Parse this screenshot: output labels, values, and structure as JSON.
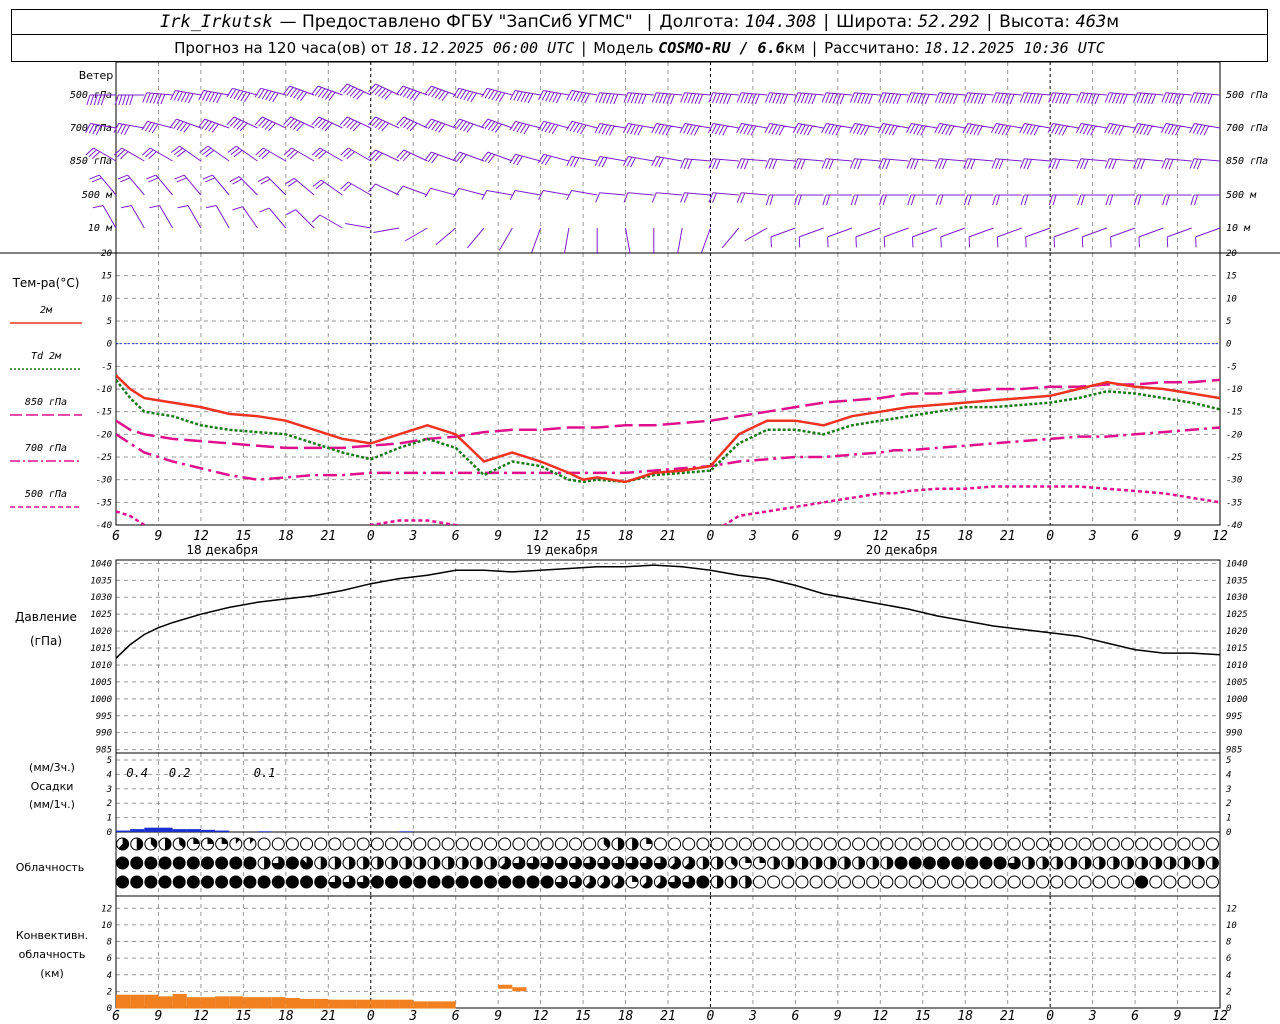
{
  "header": {
    "station": "Irk_Irkutsk",
    "provider": "— Предоставлено ФГБУ \"ЗапСиб УГМС\"",
    "lon_label": "Долгота:",
    "lon": "104.308",
    "lat_label": "Широта:",
    "lat": "52.292",
    "alt_label": "Высота:",
    "alt": "463",
    "alt_unit": "м",
    "forecast_label": "Прогноз на 120 часа(ов) от",
    "forecast_start": "18.12.2025 06:00 UTC",
    "model_label": "Модель",
    "model": "COSMO-RU / 6.6",
    "model_unit": "км",
    "calc_label": "Рассчитано:",
    "calc_time": "18.12.2025 10:36 UTC"
  },
  "wind_panel": {
    "title": "Ветер",
    "levels": [
      "500 гПа",
      "700 гПа",
      "850 гПа",
      "500 м",
      "10  м"
    ],
    "color": "#7b1fd0"
  },
  "temp_panel": {
    "title": "Тем-ра(°C)",
    "legend": [
      {
        "label": "2м",
        "color": "#ee3322",
        "style": "solid"
      },
      {
        "label": "Td  2м",
        "color": "#1a7a1a",
        "style": "dot"
      },
      {
        "label": "850 гПа",
        "color": "#e0108c",
        "style": "longdash"
      },
      {
        "label": "700 гПа",
        "color": "#e0108c",
        "style": "dashdot"
      },
      {
        "label": "500 гПа",
        "color": "#e0108c",
        "style": "dash"
      }
    ],
    "yticks": [
      20,
      15,
      10,
      5,
      0,
      -5,
      -10,
      -15,
      -20,
      -25,
      -30,
      -35,
      -40
    ]
  },
  "pressure_panel": {
    "title": "Давление",
    "unit": "(гПа)",
    "yticks": [
      1040,
      1035,
      1030,
      1025,
      1020,
      1015,
      1010,
      1005,
      1000,
      995,
      990,
      985
    ]
  },
  "precip_panel": {
    "unit1": "(мм/3ч.)",
    "title": "Осадки",
    "unit2": "(мм/1ч.)",
    "yticks": [
      5,
      4,
      3,
      2,
      1,
      0
    ],
    "annotations": [
      {
        "x": 1.5,
        "text": "0.4"
      },
      {
        "x": 4.5,
        "text": "0.2"
      },
      {
        "x": 10.5,
        "text": "0.1"
      }
    ]
  },
  "cloud_panel": {
    "title": "Облачность"
  },
  "conv_panel": {
    "title1": "Конвективн.",
    "title2": "облачность",
    "unit": "(км)",
    "yticks": [
      12,
      10,
      8,
      6,
      4,
      2,
      0
    ]
  },
  "days": [
    {
      "x": 7.5,
      "label": "18 декабря"
    },
    {
      "x": 31.5,
      "label": "19 декабря"
    },
    {
      "x": 55.5,
      "label": "20 декабря"
    }
  ],
  "hour_labels": [
    "6",
    "9",
    "12",
    "15",
    "18",
    "21",
    "0",
    "3",
    "6",
    "9",
    "12",
    "15",
    "18",
    "21",
    "0",
    "3",
    "6",
    "9",
    "12",
    "15",
    "18",
    "21",
    "0",
    "3",
    "6",
    "9",
    "12"
  ],
  "chart_data": {
    "type": "line",
    "x_axis": "hours since 18.12.2025 06:00 UTC",
    "x_range": [
      0,
      78
    ],
    "temperature": {
      "x": [
        0,
        1,
        2,
        4,
        6,
        8,
        10,
        12,
        14,
        16,
        18,
        20,
        22,
        24,
        26,
        28,
        30,
        32,
        33,
        34,
        36,
        38,
        40,
        42,
        44,
        46,
        48,
        50,
        52,
        54,
        55,
        56,
        58,
        60,
        62,
        64,
        66,
        68,
        70,
        72,
        74,
        76,
        78
      ],
      "t2m": [
        -7,
        -10,
        -12,
        -13,
        -14,
        -15.5,
        -16,
        -17,
        -19,
        -21,
        -22,
        -20,
        -18,
        -20,
        -26,
        -24,
        -26,
        -28.5,
        -30,
        -29.5,
        -30.5,
        -28.5,
        -28,
        -27,
        -20,
        -17,
        -17,
        -18,
        -16,
        -15,
        -14.5,
        -14,
        -13.5,
        -13,
        -12.5,
        -12,
        -11.5,
        -10,
        -8.5,
        -9.5,
        -10,
        -11,
        -12
      ],
      "td2m": [
        -8,
        -12,
        -15,
        -16,
        -18,
        -19,
        -19.5,
        -20,
        -22,
        -24,
        -25.5,
        -23,
        -21,
        -23,
        -29,
        -26,
        -27,
        -30,
        -30.5,
        -30,
        -30.5,
        -29,
        -28.5,
        -28,
        -22,
        -19,
        -19,
        -20,
        -18,
        -17,
        -16.5,
        -16,
        -15,
        -14,
        -14,
        -13.5,
        -13,
        -12,
        -10.5,
        -11,
        -12,
        -13,
        -14.5
      ],
      "t850": [
        -17,
        -19,
        -20,
        -21,
        -21.5,
        -22,
        -22.5,
        -23,
        -23,
        -23,
        -22.5,
        -22,
        -21,
        -20.5,
        -19.5,
        -19,
        -19,
        -18.5,
        -18.5,
        -18.5,
        -18,
        -18,
        -17.5,
        -17,
        -16,
        -15,
        -14,
        -13,
        -12.5,
        -12,
        -11.5,
        -11,
        -11,
        -10.5,
        -10,
        -10,
        -9.5,
        -9.5,
        -9,
        -9,
        -8.5,
        -8.5,
        -8
      ],
      "t700": [
        -20,
        -22,
        -24,
        -26,
        -27.5,
        -29,
        -30,
        -29.5,
        -29,
        -29,
        -28.5,
        -28.5,
        -28.5,
        -28.5,
        -28.5,
        -28.5,
        -28.5,
        -28.5,
        -28.5,
        -28.5,
        -28.5,
        -28,
        -27.5,
        -27,
        -26,
        -25.5,
        -25,
        -25,
        -24.5,
        -24,
        -23.5,
        -23.5,
        -23,
        -22.5,
        -22,
        -21.5,
        -21,
        -20.5,
        -20.5,
        -20,
        -19.5,
        -19,
        -18.5
      ],
      "t500": [
        -37,
        -38,
        -40,
        -42,
        -44,
        -45,
        -45,
        -45,
        -45,
        -44,
        -40,
        -39,
        -39,
        -40,
        -43,
        -45,
        -46,
        -47,
        -46,
        -46,
        -45,
        -44,
        -43,
        -42,
        -38,
        -37,
        -36,
        -35,
        -34,
        -33,
        -33,
        -32.5,
        -32,
        -32,
        -31.5,
        -31.5,
        -31.5,
        -31.5,
        -32,
        -32.5,
        -33,
        -34,
        -35
      ]
    },
    "pressure": {
      "x": [
        0,
        1,
        2,
        3,
        4,
        6,
        8,
        10,
        12,
        14,
        16,
        18,
        20,
        22,
        24,
        26,
        28,
        30,
        32,
        34,
        36,
        38,
        40,
        42,
        44,
        46,
        48,
        50,
        52,
        54,
        56,
        58,
        60,
        62,
        64,
        66,
        68,
        70,
        72,
        74,
        76,
        78
      ],
      "values": [
        1012,
        1016,
        1019,
        1021,
        1022.5,
        1025,
        1027,
        1028.5,
        1029.5,
        1030.5,
        1032,
        1034,
        1035.5,
        1036.5,
        1038,
        1038,
        1037.5,
        1038,
        1038.5,
        1039,
        1039,
        1039.5,
        1039,
        1038,
        1036.5,
        1035.5,
        1033.5,
        1031,
        1029.5,
        1028,
        1026.5,
        1024.5,
        1023,
        1021.5,
        1020.5,
        1019.5,
        1018.5,
        1016.5,
        1014.5,
        1013.5,
        1013.5,
        1013
      ]
    },
    "precip": {
      "x": [
        0,
        1,
        2,
        3,
        4,
        5,
        6,
        7,
        10,
        20
      ],
      "values": [
        0.1,
        0.2,
        0.3,
        0.3,
        0.2,
        0.2,
        0.15,
        0.1,
        0.05,
        0.05
      ],
      "color": "#1a2fd0"
    },
    "convective_cloud": {
      "x": [
        0,
        1,
        2,
        3,
        4,
        5,
        6,
        7,
        8,
        9,
        10,
        11,
        12,
        13,
        14,
        15,
        16,
        17,
        18,
        19,
        20,
        21,
        22,
        23,
        24,
        25,
        26,
        27,
        28,
        29,
        30,
        31,
        32,
        33,
        34,
        35,
        36,
        37,
        38,
        39,
        40,
        41,
        42,
        43,
        44,
        45,
        46,
        47,
        48,
        49,
        50,
        51,
        52,
        53,
        54,
        55,
        56,
        57,
        58,
        59,
        60,
        61,
        62,
        63,
        64,
        65,
        66,
        67,
        68,
        69,
        70,
        71,
        72,
        73,
        74,
        75,
        76,
        77
      ],
      "values": [
        1.6,
        1.6,
        1.6,
        1.4,
        1.7,
        1.3,
        1.3,
        1.4,
        1.4,
        1.3,
        1.3,
        1.3,
        1.2,
        1.1,
        1.1,
        1.0,
        1.0,
        1.0,
        1.0,
        1.0,
        1.0,
        0.8,
        0.8,
        0.8,
        0,
        0,
        0,
        0,
        0,
        0,
        0,
        0,
        0,
        0,
        0,
        0,
        0,
        0,
        0,
        0,
        0,
        0,
        0,
        0,
        0,
        0,
        0,
        0,
        0,
        0,
        0,
        0,
        0,
        0,
        0,
        0,
        0,
        0,
        0,
        0,
        0,
        0,
        0,
        0,
        0,
        0,
        0,
        0,
        0,
        0,
        0,
        0,
        0,
        0,
        0,
        0,
        0,
        0
      ],
      "high_blocks": [
        {
          "x": 27,
          "values": [
            2.8,
            2.5
          ]
        }
      ],
      "color": "#f08020"
    },
    "clouds": {
      "x_step": 1,
      "low": [
        5,
        4,
        3,
        4,
        3,
        2,
        2,
        2,
        1,
        1,
        0,
        0,
        0,
        0,
        0,
        0,
        0,
        0,
        0,
        0,
        0,
        0,
        0,
        0,
        0,
        0,
        0,
        0,
        0,
        0,
        0,
        0,
        0,
        0,
        3,
        4,
        4,
        2,
        0,
        0,
        0,
        0,
        0,
        0,
        0,
        0,
        0,
        0,
        0,
        0,
        0,
        0,
        0,
        0,
        0,
        0,
        0,
        0,
        0,
        0,
        0,
        0,
        0,
        0,
        0,
        0,
        0,
        0,
        0,
        0,
        0,
        0,
        0,
        0,
        0,
        0,
        0,
        0
      ],
      "mid": [
        8,
        8,
        8,
        8,
        8,
        8,
        8,
        8,
        8,
        8,
        4,
        6,
        8,
        7,
        4,
        4,
        4,
        4,
        4,
        4,
        4,
        4,
        4,
        4,
        4,
        4,
        4,
        5,
        6,
        6,
        6,
        6,
        6,
        6,
        6,
        6,
        6,
        6,
        6,
        5,
        5,
        4,
        4,
        3,
        2,
        2,
        4,
        4,
        4,
        4,
        4,
        4,
        4,
        4,
        4,
        8,
        8,
        8,
        8,
        8,
        8,
        8,
        8,
        6,
        4,
        4,
        4,
        4,
        4,
        4,
        4,
        4,
        4,
        4,
        4,
        4,
        4,
        4
      ],
      "high": [
        8,
        8,
        8,
        8,
        8,
        8,
        8,
        8,
        8,
        8,
        8,
        8,
        8,
        8,
        8,
        6,
        6,
        6,
        8,
        8,
        8,
        8,
        8,
        8,
        8,
        8,
        8,
        8,
        8,
        8,
        8,
        6,
        6,
        5,
        5,
        5,
        2,
        5,
        5,
        6,
        6,
        8,
        4,
        4,
        4,
        0,
        0,
        0,
        0,
        0,
        0,
        0,
        0,
        0,
        0,
        0,
        0,
        0,
        0,
        0,
        0,
        0,
        0,
        0,
        0,
        0,
        0,
        0,
        0,
        0,
        0,
        0,
        8,
        0,
        0,
        0,
        0,
        0
      ]
    },
    "wind": {
      "levels": [
        "500 гПа",
        "700 гПа",
        "850 гПа",
        "500 м",
        "10 м"
      ],
      "direction_deg": [
        [
          270,
          270,
          275,
          280,
          280,
          285,
          285,
          290,
          290,
          295,
          295,
          290,
          290,
          285,
          285,
          280,
          280,
          280,
          275,
          275,
          275,
          275,
          275,
          275,
          275,
          275,
          275,
          275,
          275,
          275,
          275,
          275,
          275,
          275,
          275,
          275,
          275,
          275,
          275,
          275
        ],
        [
          280,
          280,
          285,
          290,
          290,
          295,
          295,
          295,
          295,
          295,
          295,
          295,
          290,
          290,
          290,
          285,
          285,
          285,
          280,
          280,
          280,
          280,
          280,
          280,
          280,
          280,
          280,
          280,
          280,
          280,
          280,
          280,
          280,
          280,
          280,
          280,
          280,
          280,
          280,
          280
        ],
        [
          300,
          300,
          300,
          305,
          305,
          305,
          300,
          300,
          300,
          300,
          295,
          295,
          290,
          290,
          290,
          285,
          285,
          280,
          280,
          280,
          280,
          275,
          275,
          275,
          275,
          275,
          275,
          275,
          275,
          275,
          275,
          275,
          275,
          275,
          275,
          275,
          275,
          275,
          275,
          275
        ],
        [
          320,
          320,
          320,
          320,
          320,
          315,
          315,
          310,
          305,
          300,
          295,
          290,
          285,
          285,
          280,
          280,
          280,
          280,
          275,
          275,
          275,
          275,
          275,
          275,
          270,
          270,
          270,
          270,
          270,
          270,
          270,
          270,
          270,
          270,
          270,
          270,
          270,
          270,
          270,
          270
        ],
        [
          330,
          330,
          330,
          330,
          330,
          325,
          320,
          315,
          300,
          280,
          260,
          240,
          230,
          220,
          210,
          200,
          190,
          180,
          170,
          180,
          190,
          200,
          220,
          240,
          250,
          250,
          250,
          250,
          250,
          250,
          250,
          250,
          250,
          250,
          250,
          250,
          250,
          250,
          250,
          250
        ]
      ],
      "speed_ms": [
        [
          20,
          22,
          24,
          25,
          26,
          27,
          27,
          28,
          28,
          28,
          28,
          27,
          27,
          26,
          26,
          25,
          25,
          25,
          25,
          25,
          25,
          26,
          26,
          27,
          27,
          28,
          28,
          28,
          28,
          28,
          28,
          28,
          28,
          28,
          28,
          28,
          28,
          28,
          28,
          28
        ],
        [
          18,
          18,
          19,
          20,
          20,
          21,
          21,
          22,
          22,
          22,
          22,
          22,
          21,
          21,
          20,
          20,
          20,
          20,
          20,
          20,
          20,
          21,
          21,
          21,
          22,
          22,
          22,
          22,
          22,
          22,
          22,
          22,
          22,
          22,
          22,
          22,
          22,
          22,
          22,
          22
        ],
        [
          14,
          14,
          15,
          15,
          15,
          15,
          15,
          15,
          14,
          14,
          13,
          13,
          12,
          12,
          12,
          12,
          12,
          12,
          12,
          12,
          12,
          12,
          12,
          12,
          12,
          12,
          12,
          12,
          13,
          13,
          13,
          13,
          13,
          13,
          13,
          13,
          13,
          13,
          13,
          13
        ],
        [
          10,
          10,
          10,
          10,
          10,
          10,
          10,
          9,
          9,
          8,
          7,
          7,
          6,
          6,
          6,
          6,
          6,
          6,
          7,
          7,
          7,
          8,
          8,
          8,
          9,
          9,
          9,
          9,
          10,
          10,
          10,
          10,
          10,
          10,
          10,
          10,
          10,
          10,
          10,
          10
        ],
        [
          6,
          6,
          6,
          6,
          5,
          5,
          5,
          4,
          4,
          3,
          3,
          2,
          2,
          2,
          2,
          2,
          2,
          2,
          2,
          2,
          2,
          2,
          3,
          3,
          4,
          4,
          4,
          5,
          5,
          5,
          5,
          5,
          5,
          5,
          5,
          5,
          5,
          5,
          5,
          5
        ]
      ]
    }
  }
}
